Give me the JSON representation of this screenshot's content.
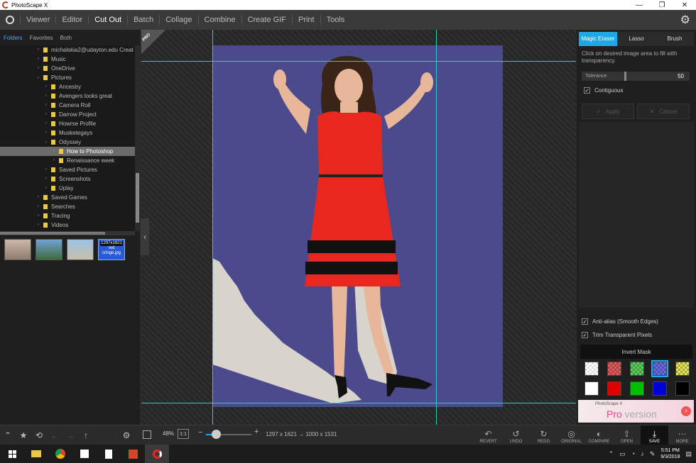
{
  "window": {
    "title": "PhotoScape X",
    "controls": [
      "—",
      "❐",
      "✕"
    ]
  },
  "menu": {
    "items": [
      "Viewer",
      "Editor",
      "Cut Out",
      "Batch",
      "Collage",
      "Combine",
      "Create GIF",
      "Print",
      "Tools"
    ],
    "active": "Cut Out"
  },
  "folders": {
    "tabs": [
      "Folders",
      "Favorites",
      "Both"
    ],
    "active_tab": "Folders",
    "tree": [
      {
        "label": "michalskia2@udayton.edu Creat",
        "depth": 1,
        "arrow": "›"
      },
      {
        "label": "Music",
        "depth": 1,
        "arrow": "›"
      },
      {
        "label": "OneDrive",
        "depth": 1,
        "arrow": "›"
      },
      {
        "label": "Pictures",
        "depth": 1,
        "arrow": "⌄"
      },
      {
        "label": "Ancestry",
        "depth": 2,
        "arrow": "›"
      },
      {
        "label": "Avengers looks great",
        "depth": 2,
        "arrow": "›"
      },
      {
        "label": "Camera Roll",
        "depth": 2,
        "arrow": "›"
      },
      {
        "label": "Darrow Project",
        "depth": 2,
        "arrow": "›"
      },
      {
        "label": "Howrse Profile",
        "depth": 2,
        "arrow": "›"
      },
      {
        "label": "Musketegays",
        "depth": 2,
        "arrow": "›"
      },
      {
        "label": "Odyssey",
        "depth": 2,
        "arrow": "⌄"
      },
      {
        "label": "How to Photoshop",
        "depth": 3,
        "arrow": "›",
        "selected": true
      },
      {
        "label": "Renaissance week",
        "depth": 3,
        "arrow": "›"
      },
      {
        "label": "Saved Pictures",
        "depth": 2,
        "arrow": "›"
      },
      {
        "label": "Screenshots",
        "depth": 2,
        "arrow": "›"
      },
      {
        "label": "Uplay",
        "depth": 2,
        "arrow": "›"
      },
      {
        "label": "Saved Games",
        "depth": 1,
        "arrow": "›"
      },
      {
        "label": "Searches",
        "depth": 1,
        "arrow": "›"
      },
      {
        "label": "Tracing",
        "depth": 1,
        "arrow": "›"
      },
      {
        "label": "Videos",
        "depth": 1,
        "arrow": "›"
      }
    ],
    "selected_thumb": {
      "dims": "1297x1621",
      "name": "red cringe.jpg"
    }
  },
  "canvas": {
    "badge": "PRO",
    "collapse_icon": "‹"
  },
  "cutout": {
    "tabs": [
      "Magic Eraser",
      "Lasso",
      "Brush"
    ],
    "active_tab": "Magic Eraser",
    "hint": "Click on desired image area to fill with transparency.",
    "tolerance_label": "Tolerance",
    "tolerance_value": "50",
    "contiguous_label": "Contiguous",
    "contiguous_checked": true,
    "apply_label": "Apply",
    "cancel_label": "Cancel",
    "antialias_label": "Anti-alias (Smooth Edges)",
    "antialias_checked": true,
    "trim_label": "Trim Transparent Pixels",
    "trim_checked": true,
    "invert_label": "Invert Mask",
    "swatches": [
      {
        "color": "checker"
      },
      {
        "color": "#e85a5a",
        "checker": true
      },
      {
        "color": "#5ad15a",
        "checker": true
      },
      {
        "color": "#6a6ae8",
        "checker": true,
        "selected": true
      },
      {
        "color": "#e8e85a",
        "checker": true
      },
      {
        "color": "#ffffff"
      },
      {
        "color": "#e00000"
      },
      {
        "color": "#00c000"
      },
      {
        "color": "#0000d8"
      },
      {
        "color": "#000000"
      }
    ],
    "ad": {
      "small": "PhotoScape X",
      "big_a": "Pro",
      "big_b": " version",
      "arrow": "›"
    }
  },
  "bottom": {
    "left_icons": [
      "⌃",
      "★",
      "⟲",
      "←",
      "→",
      "↑",
      "⚙"
    ],
    "zoom": "48%",
    "one_to_one": "1:1",
    "minus": "−",
    "plus": "+",
    "dims": "1297 x 1621 → 1000 x 1531",
    "zoom_fraction": 0.2,
    "actions": [
      {
        "icon": "↶",
        "label": "REVERT"
      },
      {
        "icon": "↺",
        "label": "UNDO"
      },
      {
        "icon": "↻",
        "label": "REDO"
      },
      {
        "icon": "◎",
        "label": "ORIGINAL"
      },
      {
        "icon": "◐",
        "label": "COMPARE"
      },
      {
        "icon": "⇪",
        "label": "OPEN"
      },
      {
        "icon": "⤓",
        "label": "SAVE"
      },
      {
        "icon": "⋯",
        "label": "MORE"
      }
    ]
  },
  "taskbar": {
    "time": "5:51 PM",
    "date": "9/3/2018"
  },
  "colors": {
    "accent": "#1ea8e6",
    "photo_bg": "#4a4a8c",
    "dress": "#e8281e",
    "guide": "#3fc3c3"
  }
}
